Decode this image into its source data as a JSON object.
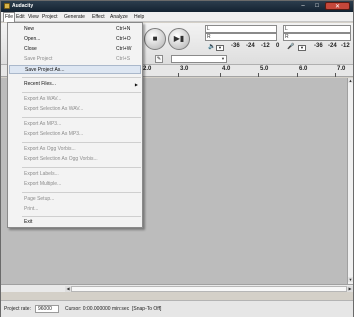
{
  "window": {
    "title": "Audacity"
  },
  "menubar": {
    "items": [
      {
        "label": "File",
        "active": true
      },
      {
        "label": "Edit"
      },
      {
        "label": "View"
      },
      {
        "label": "Project"
      },
      {
        "label": "Generate"
      },
      {
        "label": "Effect"
      },
      {
        "label": "Analyze"
      },
      {
        "label": "Help"
      }
    ]
  },
  "file_menu": {
    "items": [
      {
        "label": "New",
        "shortcut": "Ctrl+N"
      },
      {
        "label": "Open...",
        "shortcut": "Ctrl+O"
      },
      {
        "label": "Close",
        "shortcut": "Ctrl+W"
      },
      {
        "label": "Save Project",
        "shortcut": "Ctrl+S",
        "disabled": true
      },
      {
        "label": "Save Project As...",
        "highlighted": true
      },
      {
        "label": "Recent Files...",
        "submenu": true
      },
      {
        "label": "Export As WAV...",
        "disabled": true
      },
      {
        "label": "Export Selection As WAV...",
        "disabled": true
      },
      {
        "label": "Export As MP3...",
        "disabled": true
      },
      {
        "label": "Export Selection As MP3...",
        "disabled": true
      },
      {
        "label": "Export As Ogg Vorbis...",
        "disabled": true
      },
      {
        "label": "Export Selection As Ogg Vorbis...",
        "disabled": true
      },
      {
        "label": "Export Labels...",
        "disabled": true
      },
      {
        "label": "Export Multiple...",
        "disabled": true
      },
      {
        "label": "Page Setup...",
        "disabled": true
      },
      {
        "label": "Print...",
        "disabled": true
      },
      {
        "label": "Exit"
      }
    ]
  },
  "toolbar": {
    "meter_play": {
      "channel_left": "L",
      "channel_right": "R"
    },
    "meter_record": {
      "channel_left": "L",
      "channel_right": "R"
    },
    "meter_scale_play": [
      "-36",
      "-24",
      "-12",
      "0"
    ],
    "meter_scale_record": [
      "-36",
      "-24",
      "-12"
    ]
  },
  "ruler": {
    "ticks": [
      "2.0",
      "3.0",
      "4.0",
      "5.0",
      "6.0",
      "7.0"
    ]
  },
  "statusbar": {
    "project_rate_label": "Project rate:",
    "project_rate_value": "96000",
    "cursor_text": "Cursor: 0:00.000000 min:sec",
    "snap_text": "[Snap-To Off]"
  },
  "colors": {
    "titlebar": "#1d2d3d",
    "menu_highlight": "#dde6f2",
    "disabled_text": "#8c8c8c",
    "track_area": "#bcbcbc"
  }
}
